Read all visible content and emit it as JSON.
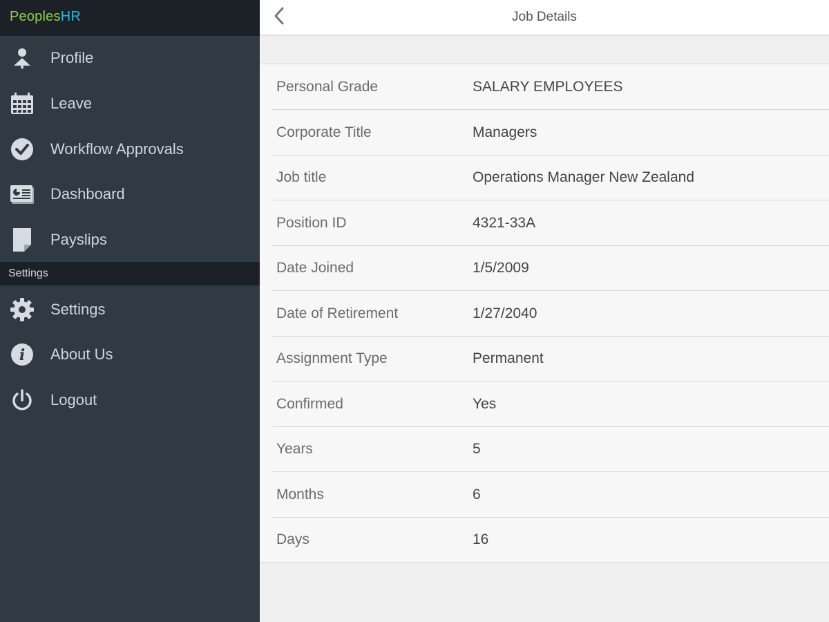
{
  "brand": {
    "part1": "Peoples",
    "part2": "HR"
  },
  "sidebar": {
    "items": [
      {
        "label": "Profile",
        "icon": "profile-icon"
      },
      {
        "label": "Leave",
        "icon": "calendar-icon"
      },
      {
        "label": "Workflow Approvals",
        "icon": "checkmark-circle-icon"
      },
      {
        "label": "Dashboard",
        "icon": "dashboard-icon"
      },
      {
        "label": "Payslips",
        "icon": "document-icon"
      }
    ],
    "section_header": "Settings",
    "settings_items": [
      {
        "label": "Settings",
        "icon": "gear-icon"
      },
      {
        "label": "About Us",
        "icon": "info-icon"
      },
      {
        "label": "Logout",
        "icon": "power-icon"
      }
    ]
  },
  "header": {
    "title": "Job Details",
    "back_icon": "chevron-left-icon"
  },
  "details": [
    {
      "label": "Personal Grade",
      "value": "SALARY EMPLOYEES"
    },
    {
      "label": "Corporate Title",
      "value": "Managers"
    },
    {
      "label": "Job title",
      "value": "Operations Manager New Zealand"
    },
    {
      "label": "Position ID",
      "value": "4321-33A"
    },
    {
      "label": "Date Joined",
      "value": "1/5/2009"
    },
    {
      "label": "Date of Retirement",
      "value": "1/27/2040"
    },
    {
      "label": "Assignment Type",
      "value": "Permanent"
    },
    {
      "label": "Confirmed",
      "value": "Yes"
    },
    {
      "label": "Years",
      "value": "5"
    },
    {
      "label": "Months",
      "value": "6"
    },
    {
      "label": "Days",
      "value": "16"
    }
  ],
  "colors": {
    "sidebar_bg": "#2f3a45",
    "sidebar_dark": "#1c2127",
    "brand_green": "#8fd14b",
    "brand_blue": "#2bb3d9",
    "content_bg": "#f7f7f7"
  }
}
